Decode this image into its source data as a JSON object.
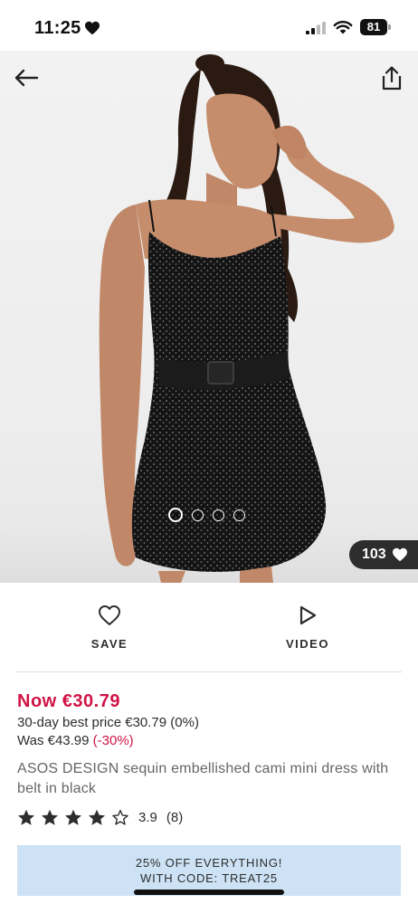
{
  "status_bar": {
    "time": "11:25",
    "battery_level": "81",
    "icons": [
      "heart-icon",
      "signal-icon",
      "wifi-icon",
      "battery-icon"
    ]
  },
  "hero": {
    "icons": [
      "back-arrow-icon",
      "share-icon",
      "heart-icon"
    ],
    "carousel": {
      "total_images": 4,
      "active_index": 0
    },
    "likes_count": "103"
  },
  "actions": {
    "save_label": "SAVE",
    "video_label": "VIDEO",
    "icons": [
      "heart-outline-icon",
      "play-icon"
    ]
  },
  "price": {
    "now": "Now €30.79",
    "best_price": "30-day best price €30.79 (0%)",
    "was": "Was €43.99",
    "discount": "(-30%)"
  },
  "product": {
    "title": "ASOS DESIGN sequin embellished cami mini dress with belt in black"
  },
  "rating": {
    "value": "3.9",
    "count": "(8)",
    "stars_filled": 4,
    "stars_total": 5
  },
  "promo": {
    "line1": "25% OFF EVERYTHING!",
    "line2": "WITH CODE: TREAT25",
    "background": "#cde2f5"
  },
  "colors": {
    "price_accent": "#d01345",
    "text": "#2d2d2d",
    "muted": "#666666"
  }
}
